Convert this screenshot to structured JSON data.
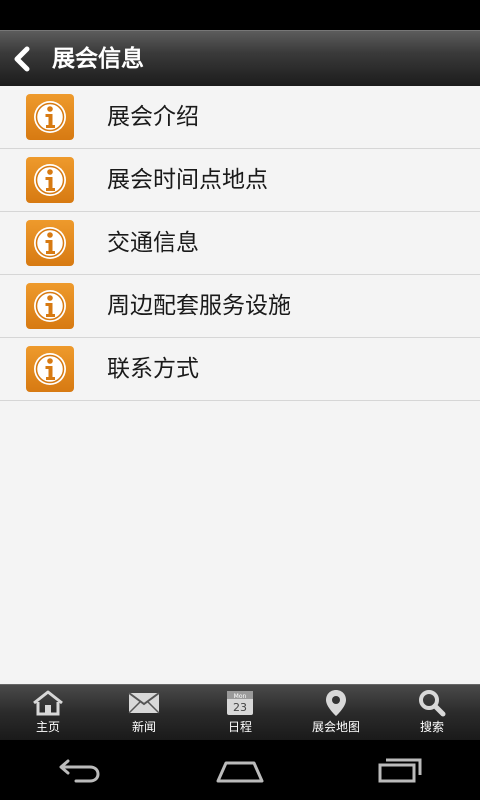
{
  "header": {
    "title": "展会信息",
    "back_icon": "chevron-left-icon"
  },
  "list": {
    "items": [
      {
        "label": "展会介绍",
        "icon": "info-icon"
      },
      {
        "label": "展会时间点地点",
        "icon": "info-icon"
      },
      {
        "label": "交通信息",
        "icon": "info-icon"
      },
      {
        "label": "周边配套服务设施",
        "icon": "info-icon"
      },
      {
        "label": "联系方式",
        "icon": "info-icon"
      }
    ]
  },
  "tabbar": {
    "tabs": [
      {
        "label": "主页",
        "icon": "home-icon"
      },
      {
        "label": "新闻",
        "icon": "mail-icon"
      },
      {
        "label": "日程",
        "icon": "calendar-icon",
        "calendar_month": "Mon",
        "calendar_day": "23"
      },
      {
        "label": "展会地图",
        "icon": "map-pin-icon"
      },
      {
        "label": "搜索",
        "icon": "search-icon"
      }
    ]
  },
  "navbar": {
    "buttons": [
      {
        "icon": "back-icon"
      },
      {
        "icon": "home-icon"
      },
      {
        "icon": "recent-apps-icon"
      }
    ]
  },
  "colors": {
    "accent_orange": "#e08a1e",
    "header_bg": "#2e2e2e",
    "list_bg": "#f4f4f4",
    "divider": "#d6d6d6"
  }
}
